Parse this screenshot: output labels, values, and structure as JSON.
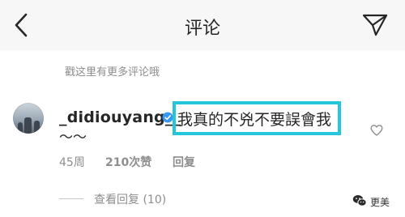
{
  "header": {
    "title": "评论",
    "back_icon": "chevron-left-icon",
    "send_icon": "direct-send-icon"
  },
  "more_comments": "戳这里有更多评论哦",
  "comment": {
    "username": "_didiouyang__",
    "verified_icon": "verified-badge-icon",
    "text_line1": "我真的不兇不要誤會我",
    "text_line2": "～～",
    "time": "45周",
    "likes": "210次赞",
    "reply_label": "回复",
    "like_icon": "heart-outline-icon",
    "view_replies": "查看回复 (10)"
  },
  "watermark": {
    "icon": "wechat-icon",
    "text": "更美"
  },
  "colors": {
    "highlight": "#25c6da",
    "verified": "#3897f0",
    "secondary_text": "#8e8e8e",
    "primary_text": "#262626",
    "header_bg": "#f7f7f7"
  }
}
